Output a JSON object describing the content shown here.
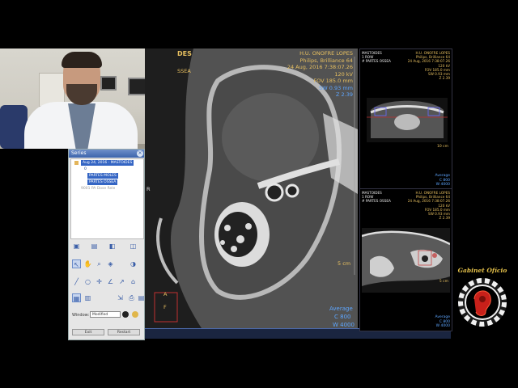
{
  "colors": {
    "accent_blue": "#3465c4",
    "ct_yellow": "#e8c060",
    "ct_blue": "#5ea6ff",
    "logo_gold": "#e6c24a",
    "logo_red": "#c8201a"
  },
  "series_panel": {
    "title": "Series",
    "tree": [
      {
        "label": "Aug 24, 2016 - MASTOIDES",
        "selected": true
      },
      {
        "label": "0",
        "selected": false
      },
      {
        "label": "PARTES MOLES",
        "selected": true
      },
      {
        "label": "PARTES OSSEA",
        "selected": true
      },
      {
        "label": "9001 PA Dose Rele",
        "selected": false
      }
    ],
    "window_label": "Window:",
    "window_value": "Modified",
    "exit_label": "Exit",
    "reset_label": "Restart"
  },
  "main_view": {
    "top_left_partial": "DES",
    "left_partial": "SSEA",
    "info_lines": [
      "H.U. ONOFRE LOPES",
      "Philips, Brilliance 64",
      "24 Aug, 2016 7:38:07.26",
      "120 kV",
      "FOV 185.0 mm"
    ],
    "sw": "SW 0.93 mm",
    "z": "Z 2.39",
    "orient_r": "R",
    "orient_a": "A",
    "orient_f": "F",
    "scale": "5 cm",
    "average_label": "Average",
    "c_value": "C  800",
    "w_value": "W  4000"
  },
  "side_view_1": {
    "left_lines": [
      "MASTOIDES",
      "1 ROW",
      "# PARTES OSSEA"
    ],
    "right_lines": [
      "H.U. ONOFRE LOPES",
      "Philips, Brilliance 64",
      "24 Aug, 2016 7:38:07.26",
      "120 kV",
      "FOV 185.0 mm",
      "SW 0.93 mm",
      "Z 2.39"
    ],
    "scale": "10 cm",
    "average_label": "Average",
    "c_value": "C  800",
    "w_value": "W  4000"
  },
  "side_view_2": {
    "left_lines": [
      "MASTOIDES",
      "1 ROW",
      "# PARTES OSSEA"
    ],
    "right_lines": [
      "H.U. ONOFRE LOPES",
      "Philips, Brilliance 64",
      "24 Aug, 2016 7:38:07.26",
      "120 kV",
      "FOV 185.0 mm",
      "SW 0.93 mm",
      "Z 2.39"
    ],
    "scale": "5 cm",
    "average_label": "Average",
    "c_value": "C  800",
    "w_value": "W  4000"
  },
  "logo": {
    "text": "Gabinet Ofício"
  }
}
